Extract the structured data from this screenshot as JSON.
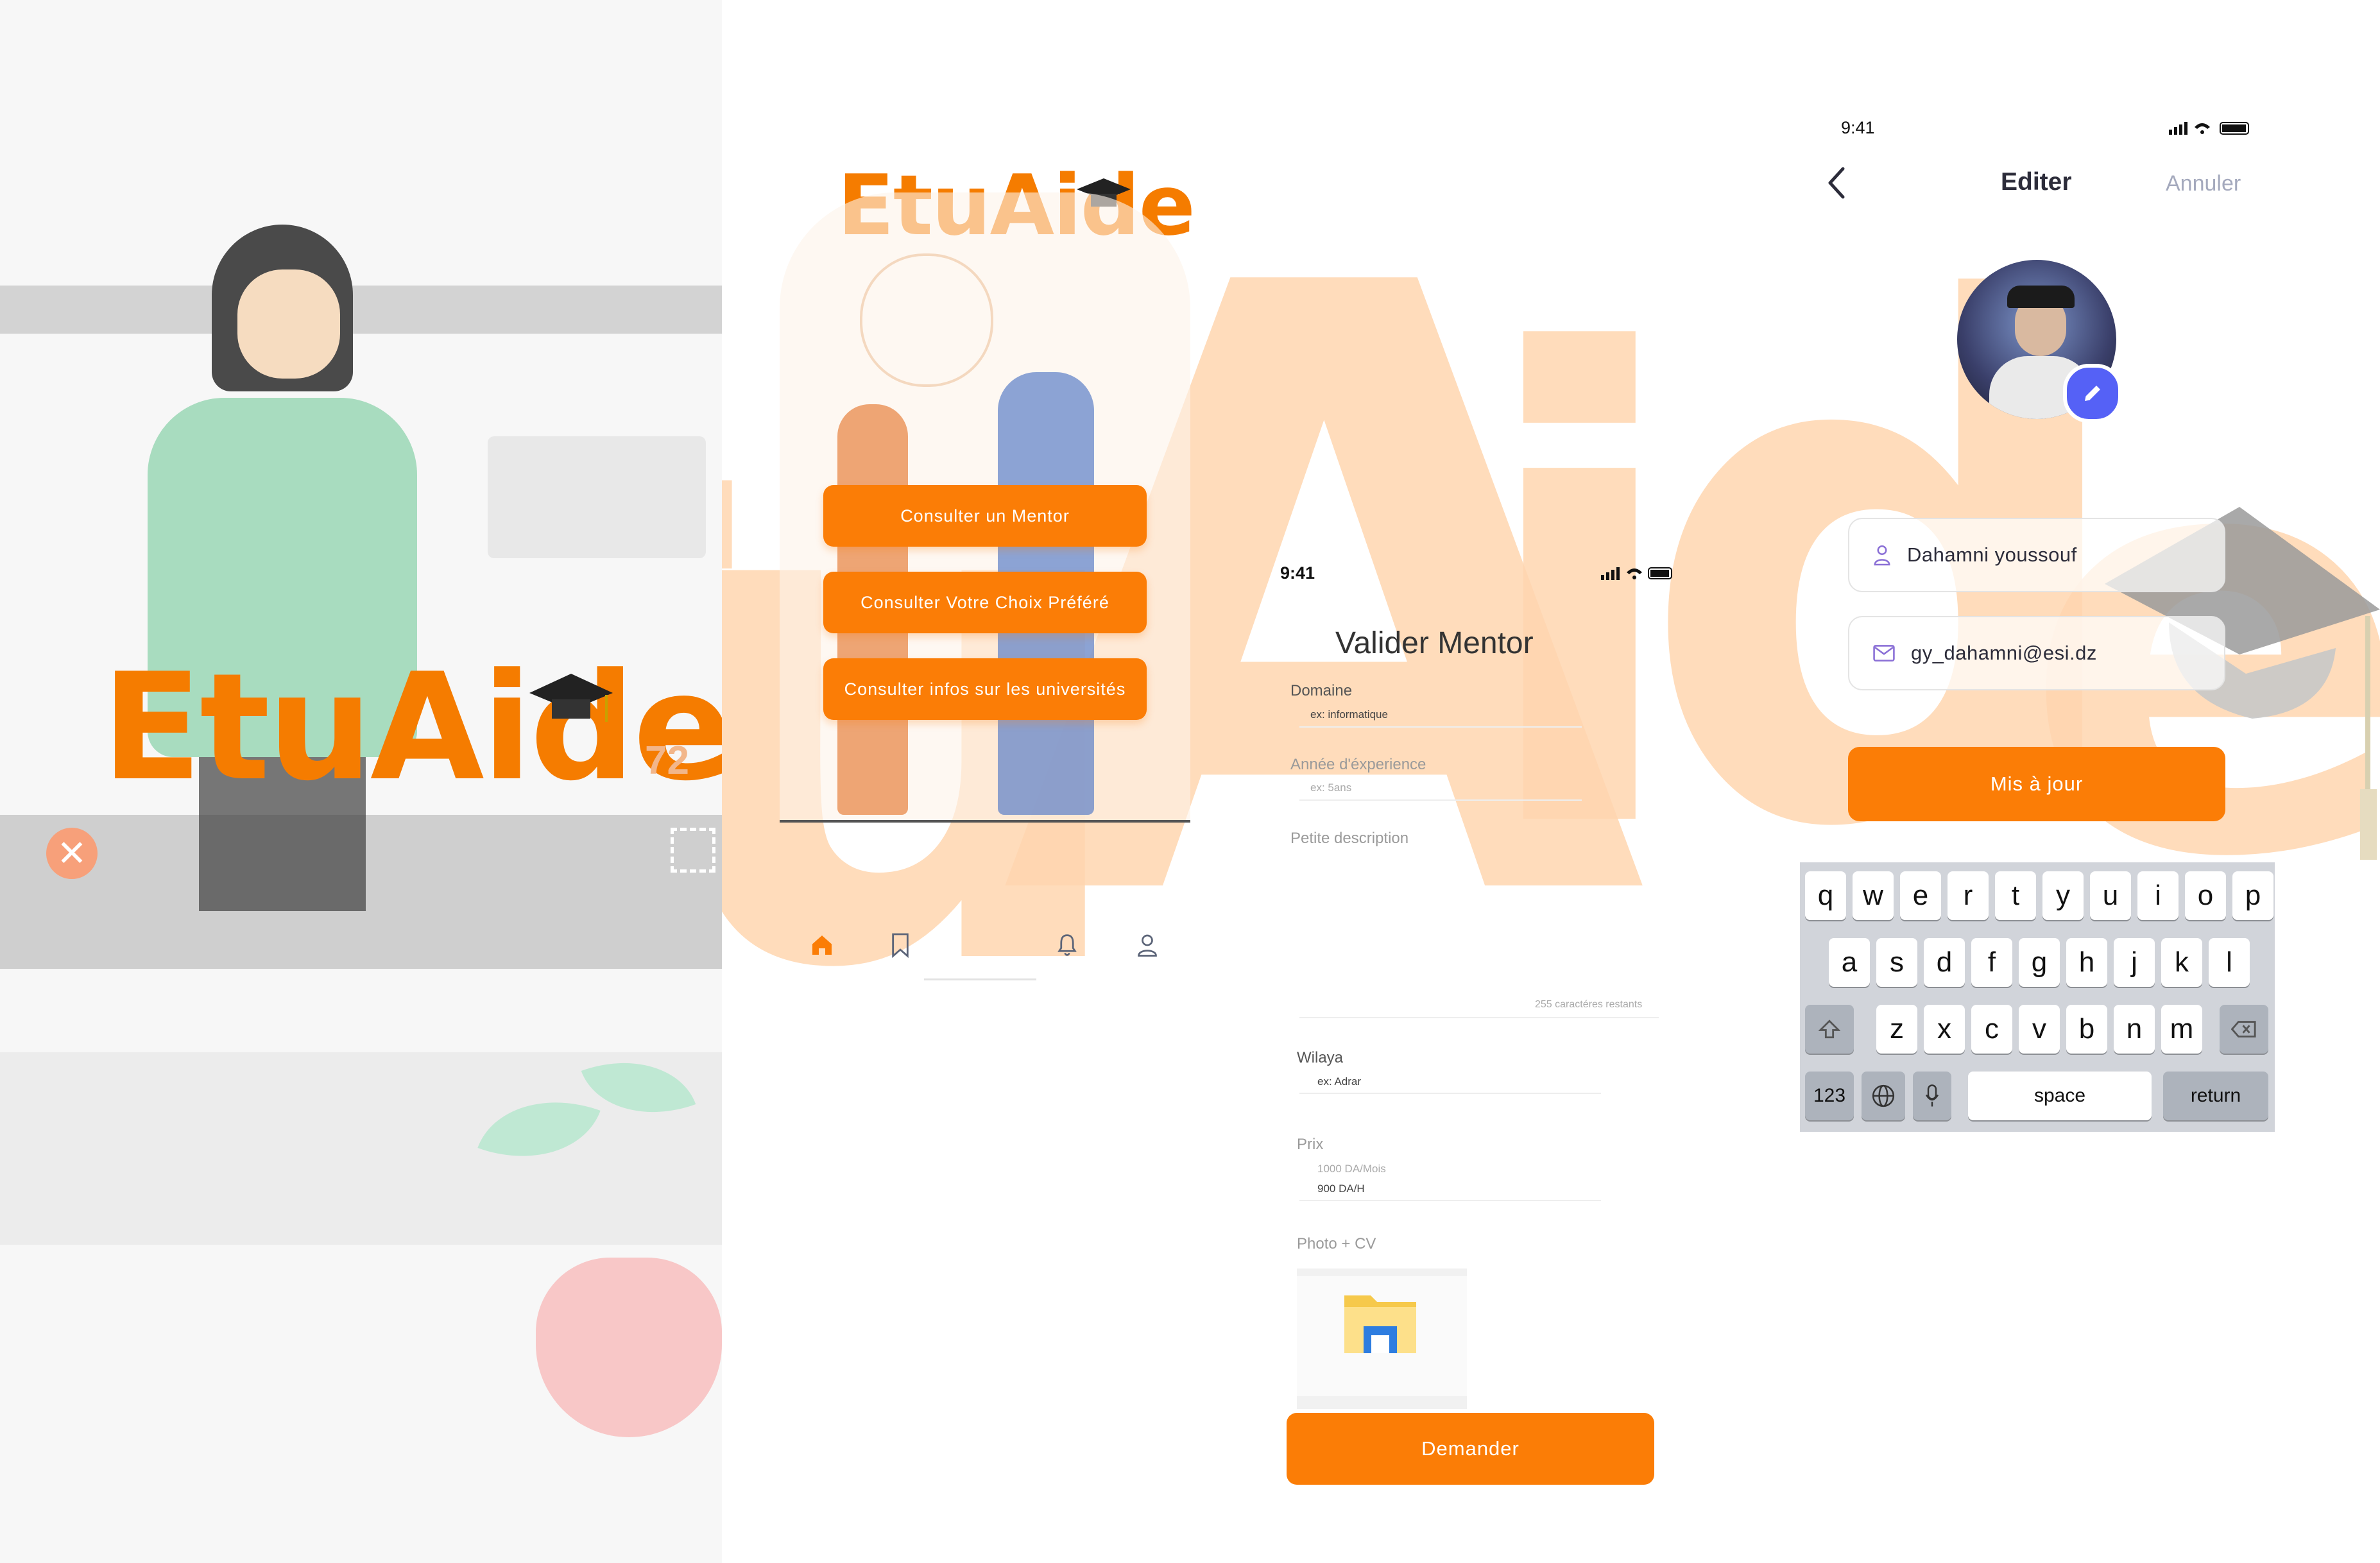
{
  "brand": {
    "name": "EtuAide",
    "accent": "#fb7d06",
    "watermark_color": "#ffd6b0"
  },
  "hero": {
    "logo": "EtuAide",
    "blurred_number": "72"
  },
  "home": {
    "logo": "EtuAide",
    "buttons": [
      "Consulter un Mentor",
      "Consulter Votre Choix Préféré",
      "Consulter infos sur les universités"
    ],
    "tabs": [
      {
        "icon": "home-icon",
        "active": true
      },
      {
        "icon": "bookmark-icon",
        "active": false
      },
      {
        "icon": "bell-icon",
        "active": false
      },
      {
        "icon": "user-icon",
        "active": false
      }
    ]
  },
  "form": {
    "status_time": "9:41",
    "title": "Valider Mentor",
    "domaine_label": "Domaine",
    "domaine_placeholder": "ex: informatique",
    "experience_label": "Année d'éxperience",
    "experience_placeholder": "ex: 5ans",
    "description_label": "Petite description",
    "char_counter": "255 caractéres restants",
    "wilaya_label": "Wilaya",
    "wilaya_placeholder": "ex: Adrar",
    "prix_label": "Prix",
    "prix_hint": "1000 DA/Mois",
    "prix_value": "900 DA/H",
    "photo_label": "Photo + CV",
    "submit": "Demander"
  },
  "edit": {
    "status_time": "9:41",
    "back_icon": "chevron-left-icon",
    "title": "Editer",
    "cancel": "Annuler",
    "name_value": "Dahamni youssouf",
    "email_value": "gy_dahamni@esi.dz",
    "update_button": "Mis à jour",
    "keyboard": {
      "row1": [
        "q",
        "w",
        "e",
        "r",
        "t",
        "y",
        "u",
        "i",
        "o",
        "p"
      ],
      "row2": [
        "a",
        "s",
        "d",
        "f",
        "g",
        "h",
        "j",
        "k",
        "l"
      ],
      "row3": [
        "z",
        "x",
        "c",
        "v",
        "b",
        "n",
        "m"
      ],
      "numbers": "123",
      "space": "space",
      "return": "return"
    }
  }
}
